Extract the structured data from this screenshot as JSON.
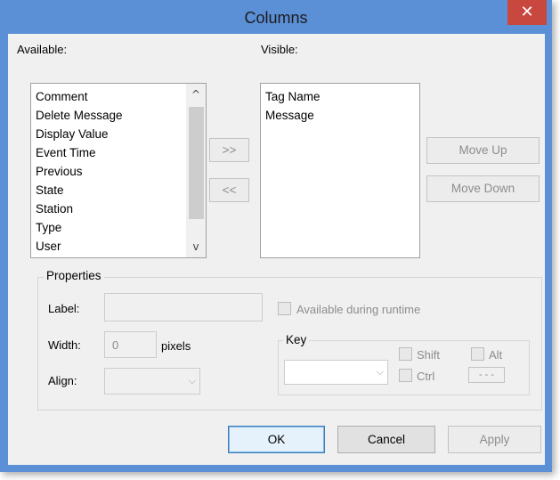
{
  "window": {
    "title": "Columns",
    "close_glyph": "✕"
  },
  "available": {
    "label": "Available:",
    "items": [
      "Comment",
      "Delete Message",
      "Display Value",
      "Event Time",
      "Previous",
      "State",
      "Station",
      "Type",
      "User"
    ],
    "scroll_up": "^",
    "scroll_down": "v"
  },
  "visible": {
    "label": "Visible:",
    "items": [
      "Tag Name",
      "Message"
    ]
  },
  "transfer": {
    "add_label": ">>",
    "remove_label": "<<"
  },
  "order": {
    "move_up_label": "Move Up",
    "move_down_label": "Move Down"
  },
  "properties": {
    "title": "Properties",
    "label_label": "Label:",
    "label_value": "",
    "width_label": "Width:",
    "width_value": "0",
    "width_unit": "pixels",
    "align_label": "Align:",
    "align_value": "",
    "available_runtime_label": "Available during runtime",
    "key": {
      "title": "Key",
      "shift_label": "Shift",
      "alt_label": "Alt",
      "ctrl_label": "Ctrl",
      "key_value": "",
      "shortcut_display": "- - -"
    }
  },
  "footer": {
    "ok_label": "OK",
    "cancel_label": "Cancel",
    "apply_label": "Apply"
  },
  "icons": {
    "combo_arrow": "chevron-down-icon",
    "close": "close-icon"
  },
  "colors": {
    "titlebar": "#5b8fd6",
    "close_button": "#c8473f",
    "default_button_border": "#3c7fb1"
  }
}
